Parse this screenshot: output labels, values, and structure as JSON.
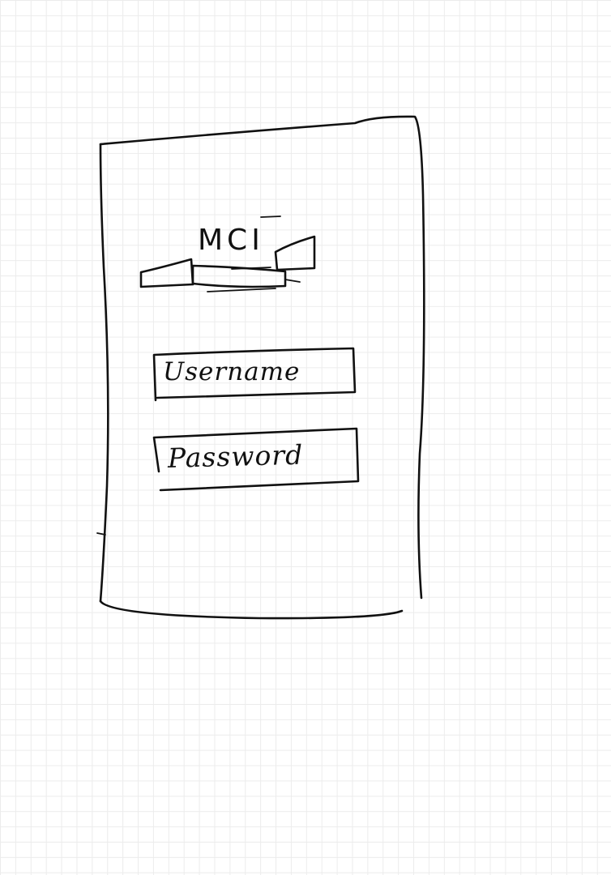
{
  "logo": {
    "text": "MCI"
  },
  "login_form": {
    "username": {
      "placeholder": "Username"
    },
    "password": {
      "placeholder": "Password"
    }
  }
}
